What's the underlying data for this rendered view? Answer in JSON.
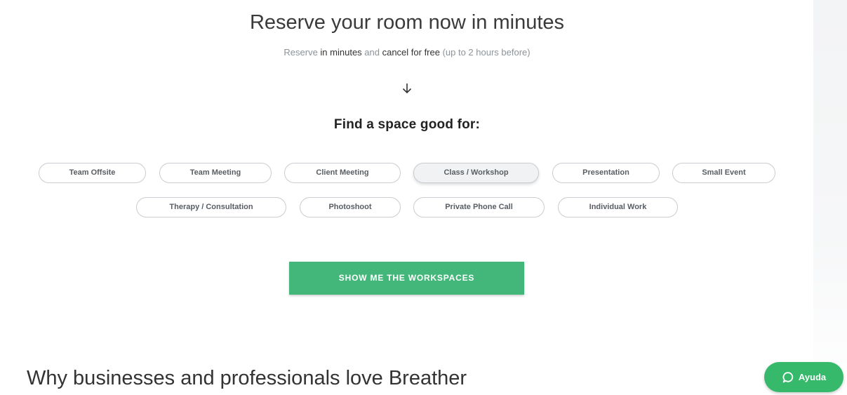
{
  "hero": {
    "title": "Reserve your room now in minutes",
    "subtitle_part1": "Reserve ",
    "subtitle_part2": "in minutes",
    "subtitle_part3": " and ",
    "subtitle_part4": "cancel for free",
    "subtitle_part5": " (up to 2 hours before)"
  },
  "finder": {
    "title": "Find a space good for:",
    "options": [
      "Team Offsite",
      "Team Meeting",
      "Client Meeting",
      "Class / Workshop",
      "Presentation",
      "Small Event",
      "Therapy / Consultation",
      "Photoshoot",
      "Private Phone Call",
      "Individual Work"
    ],
    "selected": "Class / Workshop"
  },
  "cta": {
    "label": "SHOW ME THE WORKSPACES"
  },
  "why": {
    "title": "Why businesses and professionals love Breather"
  },
  "help": {
    "label": "Ayuda"
  },
  "colors": {
    "accent_green": "#43b77a",
    "help_green": "#36b96b"
  },
  "icons": {
    "arrow": "arrow-down-icon",
    "chat": "chat-bubble-icon"
  }
}
